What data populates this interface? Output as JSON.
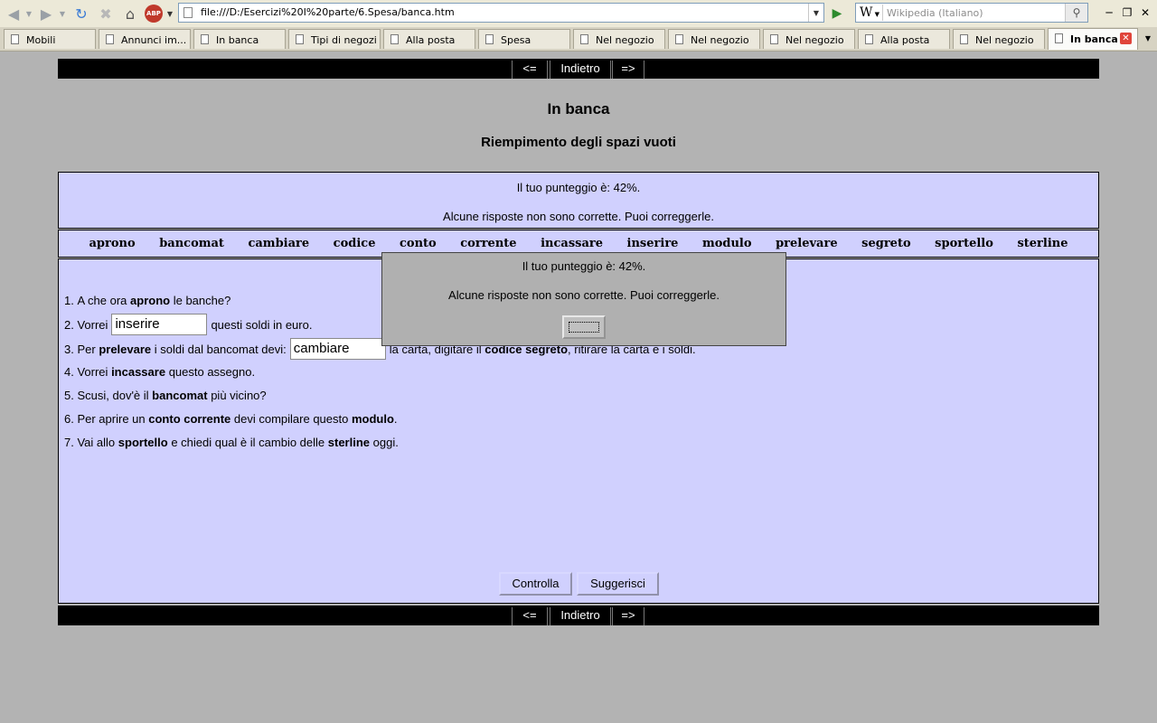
{
  "browser": {
    "url": "file:///D:/Esercizi%20I%20parte/6.Spesa/banca.htm",
    "search_placeholder": "Wikipedia (Italiano)",
    "search_engine_icon": "W",
    "addon_badge": "ABP",
    "tabs": [
      {
        "label": "Mobili"
      },
      {
        "label": "Annunci im..."
      },
      {
        "label": "In banca"
      },
      {
        "label": "Tipi di negozi"
      },
      {
        "label": "Alla posta"
      },
      {
        "label": "Spesa"
      },
      {
        "label": "Nel negozio"
      },
      {
        "label": "Nel negozio"
      },
      {
        "label": "Nel negozio"
      },
      {
        "label": "Alla posta"
      },
      {
        "label": "Nel negozio"
      },
      {
        "label": "In banca",
        "active": true
      }
    ]
  },
  "nav": {
    "prev": "<=",
    "back": "Indietro",
    "next": "=>"
  },
  "page": {
    "title": "In banca",
    "subtitle": "Riempimento degli spazi vuoti"
  },
  "feedback": {
    "score": "Il tuo punteggio è: 42%.",
    "message": "Alcune risposte non sono corrette. Puoi correggerle."
  },
  "word_bank": [
    "aprono",
    "bancomat",
    "cambiare",
    "codice",
    "conto",
    "corrente",
    "incassare",
    "inserire",
    "modulo",
    "prelevare",
    "segreto",
    "sportello",
    "sterline"
  ],
  "questions": {
    "q1": {
      "num": "1.",
      "t1": "A che ora",
      "b1": "aprono",
      "t2": "le banche?"
    },
    "q2": {
      "num": "2.",
      "t1": "Vorrei",
      "gap": "inserire",
      "t2": "questi soldi in euro."
    },
    "q3": {
      "num": "3.",
      "t1": "Per",
      "b1": "prelevare",
      "t2": "i soldi dal bancomat devi:",
      "gap": "cambiare",
      "t3": "la carta, digitare il",
      "b2": "codice segreto",
      "t4": ", ritirare la carta e i soldi."
    },
    "q4": {
      "num": "4.",
      "t1": "Vorrei",
      "b1": "incassare",
      "t2": "questo assegno."
    },
    "q5": {
      "num": "5.",
      "t1": "Scusi, dov'è il",
      "b1": "bancomat",
      "t2": "più vicino?"
    },
    "q6": {
      "num": "6.",
      "t1": "Per aprire un",
      "b1": "conto corrente",
      "t2": "devi compilare questo",
      "b2": "modulo",
      "t3": "."
    },
    "q7": {
      "num": "7.",
      "t1": "Vai allo",
      "b1": "sportello",
      "t2": "e chiedi qual è il cambio delle",
      "b2": "sterline",
      "t3": "oggi."
    }
  },
  "buttons": {
    "check": "Controlla",
    "hint": "Suggerisci"
  },
  "dialog": {
    "score": "Il tuo punteggio è: 42%.",
    "message": "Alcune risposte non sono corrette. Puoi correggerle.",
    "ok_label": ""
  }
}
